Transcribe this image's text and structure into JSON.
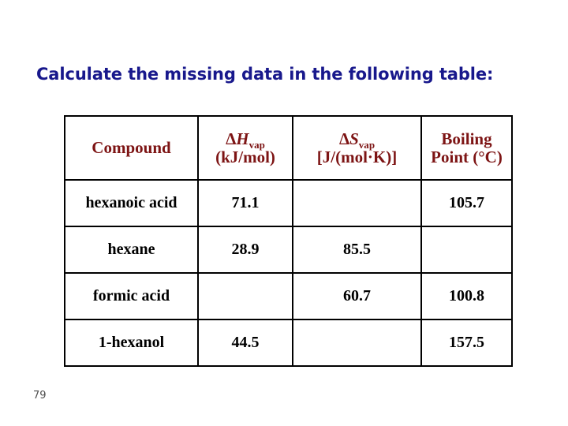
{
  "slide": {
    "title": "Calculate the missing data in the following table:",
    "page_number": "79",
    "colors": {
      "title": "#18188c",
      "header_text": "#7d1414",
      "cell_text": "#000000",
      "border": "#000000",
      "background": "#ffffff",
      "page_number": "#4d4d4d"
    }
  },
  "table": {
    "headers": {
      "compound": "Compound",
      "delta_h_symbol_prefix": "Δ",
      "delta_h_symbol_letter": "H",
      "delta_h_subscript": "vap",
      "delta_h_units": "(kJ/mol)",
      "delta_s_symbol_prefix": "Δ",
      "delta_s_symbol_letter": "S",
      "delta_s_subscript": "vap",
      "delta_s_units": "[J/(mol·K)]",
      "boiling_line1": "Boiling",
      "boiling_line2": "Point (°C)"
    },
    "rows": [
      {
        "compound": "hexanoic acid",
        "delta_h": "71.1",
        "delta_s": "",
        "boiling_point": "105.7"
      },
      {
        "compound": "hexane",
        "delta_h": "28.9",
        "delta_s": "85.5",
        "boiling_point": ""
      },
      {
        "compound": "formic acid",
        "delta_h": "",
        "delta_s": "60.7",
        "boiling_point": "100.8"
      },
      {
        "compound": "1-hexanol",
        "delta_h": "44.5",
        "delta_s": "",
        "boiling_point": "157.5"
      }
    ]
  }
}
